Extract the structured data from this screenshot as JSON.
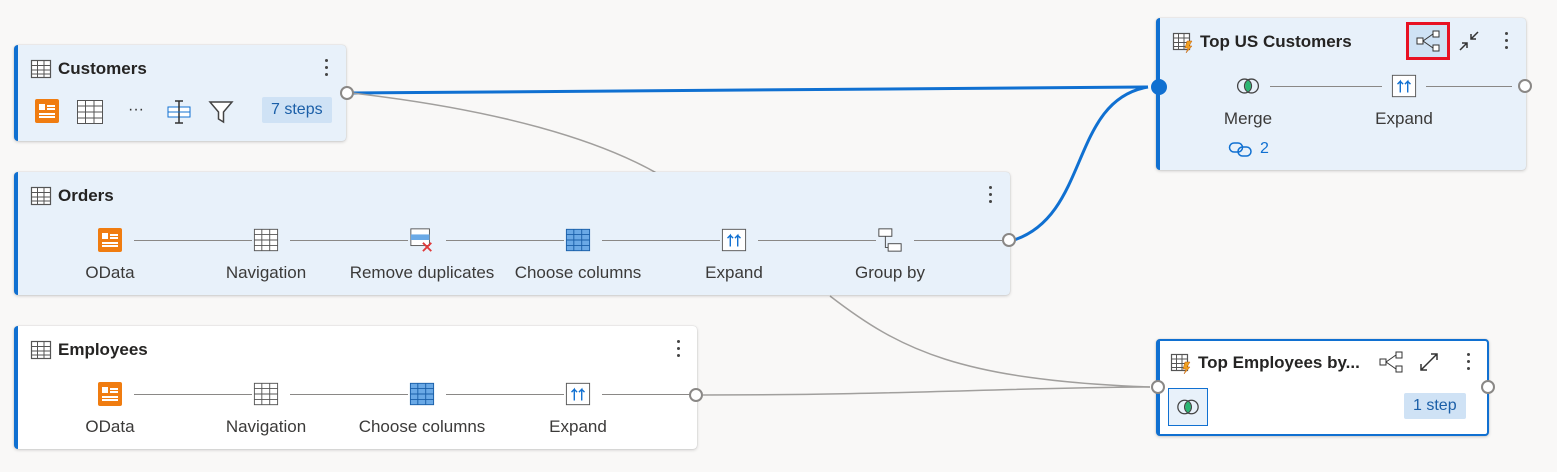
{
  "queries": {
    "customers": {
      "title": "Customers",
      "steps_badge": "7 steps",
      "ellipsis": "···"
    },
    "orders": {
      "title": "Orders",
      "steps": [
        "OData",
        "Navigation",
        "Remove duplicates",
        "Choose columns",
        "Expand",
        "Group by"
      ]
    },
    "employees": {
      "title": "Employees",
      "steps": [
        "OData",
        "Navigation",
        "Choose columns",
        "Expand"
      ]
    },
    "top_us_customers": {
      "title": "Top US Customers",
      "steps": [
        "Merge",
        "Expand"
      ],
      "link_count": "2"
    },
    "top_employees": {
      "title": "Top Employees by...",
      "steps_badge": "1 step"
    }
  },
  "colors": {
    "accent": "#1070d1",
    "highlight": "#e81123",
    "orange": "#f07c10"
  }
}
